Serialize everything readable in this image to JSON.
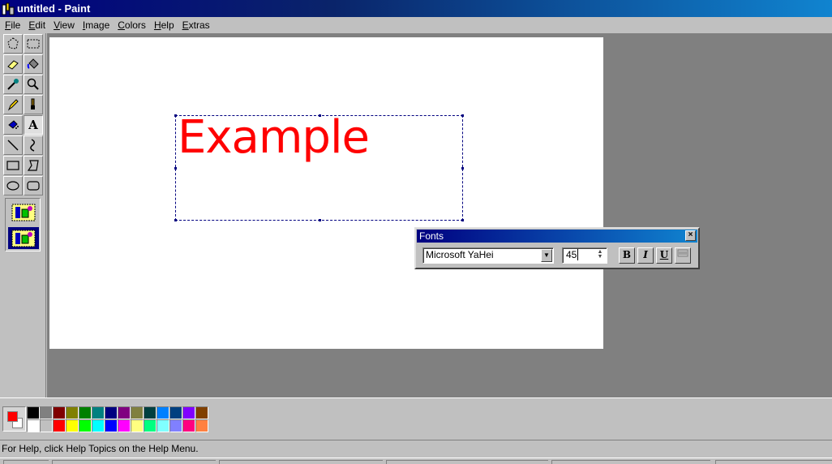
{
  "window": {
    "title": "untitled - Paint"
  },
  "menu": [
    "File",
    "Edit",
    "View",
    "Image",
    "Colors",
    "Help",
    "Extras"
  ],
  "tools": [
    {
      "name": "free-select-icon"
    },
    {
      "name": "rect-select-icon"
    },
    {
      "name": "eraser-icon"
    },
    {
      "name": "fill-bucket-icon"
    },
    {
      "name": "color-picker-icon"
    },
    {
      "name": "magnifier-icon"
    },
    {
      "name": "pencil-icon"
    },
    {
      "name": "brush-icon"
    },
    {
      "name": "airbrush-icon"
    },
    {
      "name": "text-icon",
      "glyph": "A"
    },
    {
      "name": "line-icon"
    },
    {
      "name": "curve-icon"
    },
    {
      "name": "rectangle-icon"
    },
    {
      "name": "polygon-icon"
    },
    {
      "name": "ellipse-icon"
    },
    {
      "name": "rounded-rect-icon"
    }
  ],
  "active_tool": "text-icon",
  "canvas": {
    "text": "Example",
    "text_color": "#ff0000"
  },
  "fonts_toolbar": {
    "title": "Fonts",
    "close_glyph": "×",
    "font_name": "Microsoft YaHei",
    "font_size": "45",
    "bold_label": "B",
    "italic_label": "I",
    "underline_label": "U"
  },
  "colors": {
    "foreground": "#ff0000",
    "background": "#ffffff",
    "palette": [
      "#000000",
      "#808080",
      "#800000",
      "#808000",
      "#008000",
      "#008080",
      "#000080",
      "#800080",
      "#808040",
      "#004040",
      "#0080ff",
      "#004080",
      "#8000ff",
      "#804000",
      "#ffffff",
      "#c0c0c0",
      "#ff0000",
      "#ffff00",
      "#00ff00",
      "#00ffff",
      "#0000ff",
      "#ff00ff",
      "#ffff80",
      "#00ff80",
      "#80ffff",
      "#8080ff",
      "#ff0080",
      "#ff8040"
    ]
  },
  "status": {
    "text": "For Help, click Help Topics on the Help Menu."
  }
}
